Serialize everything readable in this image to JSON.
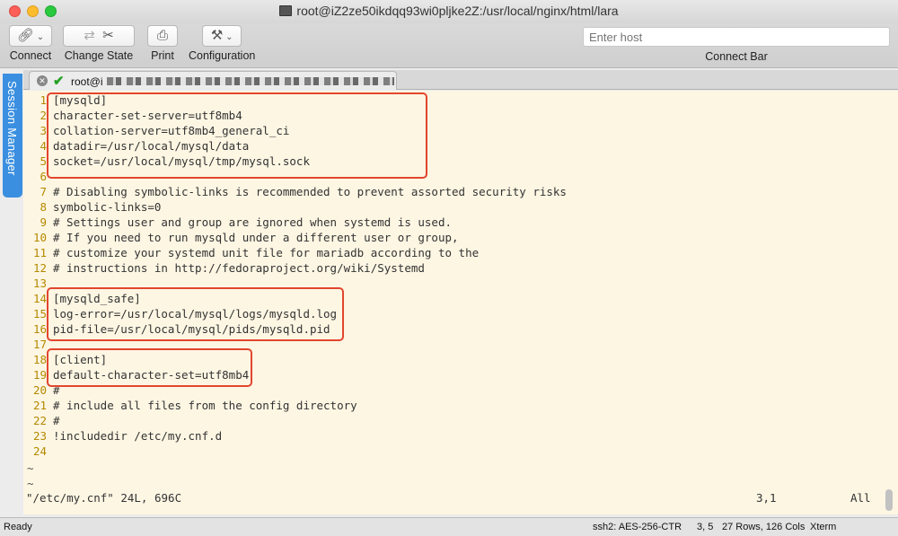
{
  "window": {
    "title": "root@iZ2ze50ikdqq93wi0pljke2Z:/usr/local/nginx/html/lara"
  },
  "toolbar": {
    "connect_label": "Connect",
    "change_state_label": "Change State",
    "print_label": "Print",
    "configuration_label": "Configuration",
    "host_placeholder": "Enter host",
    "connect_bar_label": "Connect Bar"
  },
  "sidebar": {
    "session_manager_label": "Session Manager"
  },
  "tab": {
    "label": "root@i"
  },
  "terminal": {
    "lines": [
      {
        "n": "1",
        "text": "[mysqld]"
      },
      {
        "n": "2",
        "text": "character-set-server=utf8mb4"
      },
      {
        "n": "3",
        "text": "collation-server=utf8mb4_general_ci"
      },
      {
        "n": "4",
        "text": "datadir=/usr/local/mysql/data"
      },
      {
        "n": "5",
        "text": "socket=/usr/local/mysql/tmp/mysql.sock"
      },
      {
        "n": "6",
        "text": ""
      },
      {
        "n": "7",
        "text": "# Disabling symbolic-links is recommended to prevent assorted security risks"
      },
      {
        "n": "8",
        "text": "symbolic-links=0"
      },
      {
        "n": "9",
        "text": "# Settings user and group are ignored when systemd is used."
      },
      {
        "n": "10",
        "text": "# If you need to run mysqld under a different user or group,"
      },
      {
        "n": "11",
        "text": "# customize your systemd unit file for mariadb according to the"
      },
      {
        "n": "12",
        "text": "# instructions in http://fedoraproject.org/wiki/Systemd"
      },
      {
        "n": "13",
        "text": ""
      },
      {
        "n": "14",
        "text": "[mysqld_safe]"
      },
      {
        "n": "15",
        "text": "log-error=/usr/local/mysql/logs/mysqld.log"
      },
      {
        "n": "16",
        "text": "pid-file=/usr/local/mysql/pids/mysqld.pid"
      },
      {
        "n": "17",
        "text": ""
      },
      {
        "n": "18",
        "text": "[client]"
      },
      {
        "n": "19",
        "text": "default-character-set=utf8mb4"
      },
      {
        "n": "20",
        "text": "#"
      },
      {
        "n": "21",
        "text": "# include all files from the config directory"
      },
      {
        "n": "22",
        "text": "#"
      },
      {
        "n": "23",
        "text": "!includedir /etc/my.cnf.d"
      },
      {
        "n": "24",
        "text": ""
      }
    ],
    "tilde": "~",
    "status_file": "\"/etc/my.cnf\" 24L, 696C",
    "status_pos": "3,1",
    "status_all": "All"
  },
  "statusbar": {
    "ready": "Ready",
    "ssh": "ssh2: AES-256-CTR",
    "pos": "3, 5",
    "rows_cols": "27 Rows, 126 Cols",
    "term": "Xterm"
  },
  "colors": {
    "highlight": "#e2462e",
    "terminal_bg": "#fdf6e3",
    "line_number": "#b58900",
    "session_tab": "#3a8fe0"
  }
}
